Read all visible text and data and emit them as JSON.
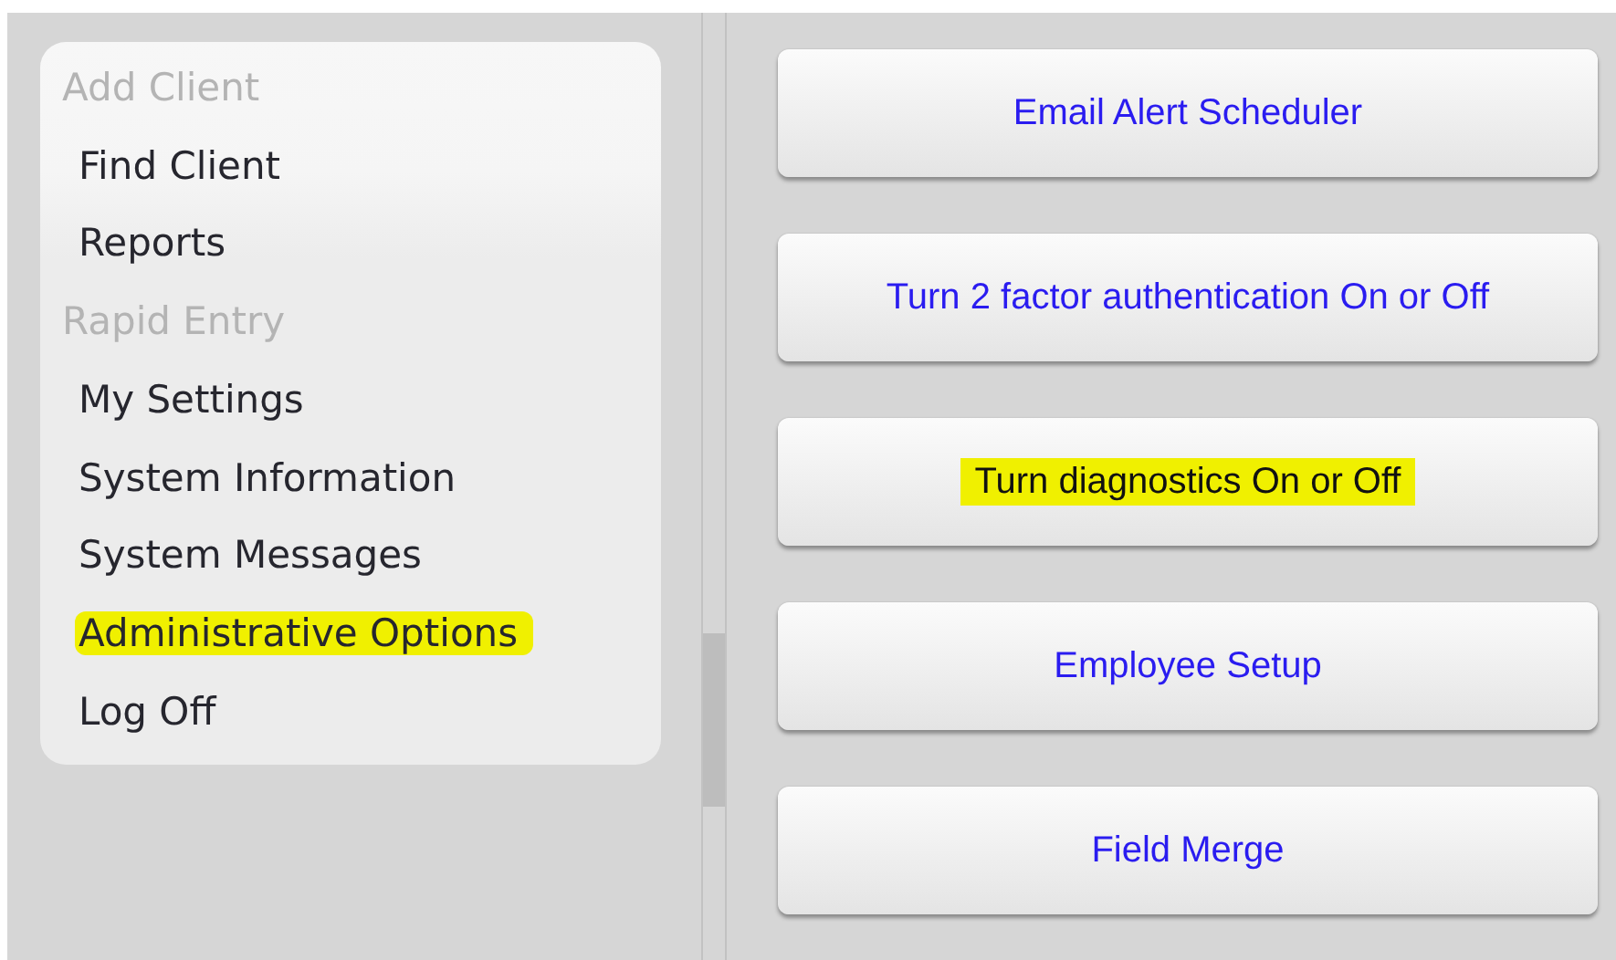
{
  "sidebar": {
    "items": [
      {
        "label": "Add Client",
        "disabled": true,
        "highlighted": false
      },
      {
        "label": "Find Client",
        "disabled": false,
        "highlighted": false
      },
      {
        "label": "Reports",
        "disabled": false,
        "highlighted": false
      },
      {
        "label": "Rapid Entry",
        "disabled": true,
        "highlighted": false
      },
      {
        "label": "My Settings",
        "disabled": false,
        "highlighted": false
      },
      {
        "label": "System Information",
        "disabled": false,
        "highlighted": false
      },
      {
        "label": "System Messages",
        "disabled": false,
        "highlighted": false
      },
      {
        "label": "Administrative Options",
        "disabled": false,
        "highlighted": true
      },
      {
        "label": "Log Off",
        "disabled": false,
        "highlighted": false
      }
    ]
  },
  "buttons": [
    {
      "label": "Email Alert Scheduler",
      "highlighted": false
    },
    {
      "label": "Turn 2 factor authentication On or Off",
      "highlighted": false
    },
    {
      "label": "Turn diagnostics On or Off",
      "highlighted": true
    },
    {
      "label": "Employee Setup",
      "highlighted": false
    },
    {
      "label": "Field Merge",
      "highlighted": false
    }
  ]
}
